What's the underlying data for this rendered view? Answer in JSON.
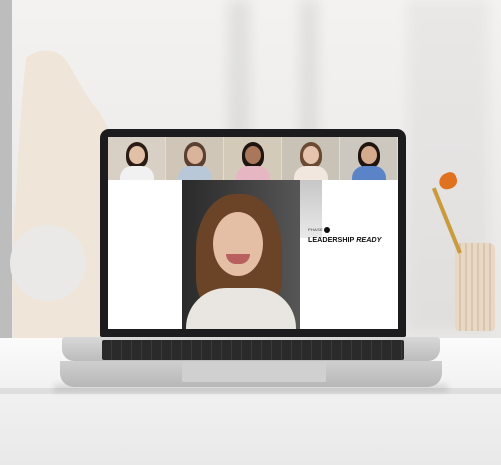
{
  "screen": {
    "brand_small": "PHASE 30",
    "brand_main": "LEADERSHIP",
    "brand_italic": "READY"
  },
  "colors": {
    "laptop_bezel": "#1c1c1e",
    "brush_tip": "#e0711f",
    "vase": "#efe5d8"
  },
  "participants": [
    {
      "name": "p1",
      "skin": "#e2c0a5",
      "hair": "#2a1b14",
      "top": "#f1f1f1",
      "bg": "#d8d0c4"
    },
    {
      "name": "p2",
      "skin": "#d9b49a",
      "hair": "#5a4030",
      "top": "#b8c8d8",
      "bg": "#cfc6b8"
    },
    {
      "name": "p3",
      "skin": "#a9775a",
      "hair": "#1e1410",
      "top": "#e6b7c3",
      "bg": "#d3cab9"
    },
    {
      "name": "p4",
      "skin": "#e5c3ac",
      "hair": "#6a4a32",
      "top": "#f2e7df",
      "bg": "#c9c2b6"
    },
    {
      "name": "p5",
      "skin": "#d5ab8e",
      "hair": "#20140f",
      "top": "#5b84c8",
      "bg": "#cdc8bf"
    }
  ]
}
